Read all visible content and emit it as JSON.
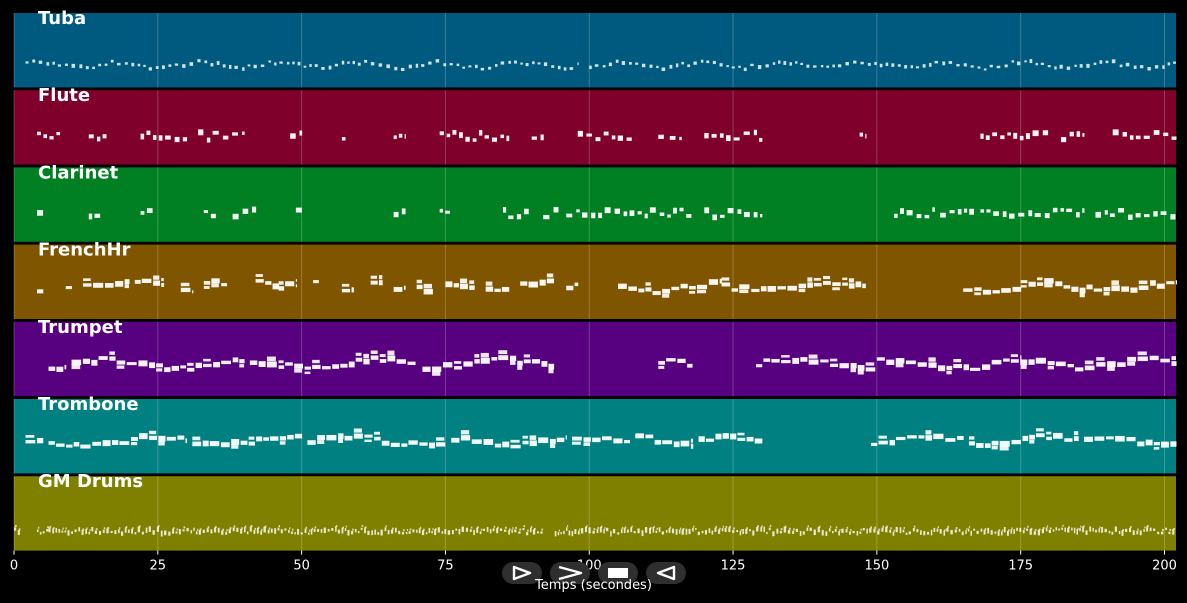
{
  "chart_data": {
    "type": "piano-roll",
    "xlabel": "Temps (secondes)",
    "xlim": [
      0,
      202
    ],
    "x_ticks": [
      0,
      25,
      50,
      75,
      100,
      125,
      150,
      175,
      200
    ],
    "grid": true,
    "tracks": [
      {
        "name": "Tuba",
        "color": "#005a80",
        "segments": [
          [
            2,
            98
          ],
          [
            100,
            202
          ]
        ],
        "style": "thin-dashes"
      },
      {
        "name": "Flute",
        "color": "#80002c",
        "segments": [
          [
            4,
            8
          ],
          [
            13,
            16
          ],
          [
            22,
            30
          ],
          [
            32,
            40
          ],
          [
            48,
            50
          ],
          [
            57,
            58
          ],
          [
            66,
            68
          ],
          [
            74,
            86
          ],
          [
            90,
            92
          ],
          [
            98,
            108
          ],
          [
            112,
            113
          ],
          [
            114,
            116
          ],
          [
            120,
            130
          ],
          [
            147,
            148
          ],
          [
            168,
            180
          ],
          [
            182,
            186
          ],
          [
            191,
            202
          ]
        ],
        "style": "sparse-blocks"
      },
      {
        "name": "Clarinet",
        "color": "#008023",
        "segments": [
          [
            4,
            5
          ],
          [
            13,
            15
          ],
          [
            22,
            24
          ],
          [
            33,
            35
          ],
          [
            38,
            42
          ],
          [
            49,
            50
          ],
          [
            66,
            68
          ],
          [
            74,
            76
          ],
          [
            85,
            90
          ],
          [
            92,
            95
          ],
          [
            96,
            118
          ],
          [
            120,
            130
          ],
          [
            153,
            160
          ],
          [
            161,
            167
          ],
          [
            168,
            186
          ],
          [
            188,
            202
          ]
        ],
        "style": "sparse-blocks"
      },
      {
        "name": "FrenchHr",
        "color": "#805500",
        "segments": [
          [
            4,
            5
          ],
          [
            9,
            10
          ],
          [
            12,
            20
          ],
          [
            21,
            26
          ],
          [
            29,
            31
          ],
          [
            33,
            37
          ],
          [
            42,
            46
          ],
          [
            46,
            49
          ],
          [
            52,
            53
          ],
          [
            57,
            59
          ],
          [
            62,
            64
          ],
          [
            66,
            68
          ],
          [
            70,
            73
          ],
          [
            75,
            80
          ],
          [
            82,
            86
          ],
          [
            88,
            94
          ],
          [
            96,
            98
          ],
          [
            105,
            123
          ],
          [
            123,
            148
          ],
          [
            165,
            175
          ],
          [
            175,
            202
          ]
        ],
        "style": "thick-line"
      },
      {
        "name": "Trumpet",
        "color": "#570080",
        "segments": [
          [
            6,
            9
          ],
          [
            10,
            40
          ],
          [
            41,
            70
          ],
          [
            71,
            94
          ],
          [
            112,
            118
          ],
          [
            129,
            150
          ],
          [
            150,
            175
          ],
          [
            175,
            202
          ]
        ],
        "style": "thick-line"
      },
      {
        "name": "Trombone",
        "color": "#008080",
        "segments": [
          [
            2,
            5
          ],
          [
            6,
            30
          ],
          [
            31,
            50
          ],
          [
            51,
            75
          ],
          [
            76,
            96
          ],
          [
            97,
            107
          ],
          [
            108,
            118
          ],
          [
            119,
            130
          ],
          [
            149,
            165
          ],
          [
            166,
            185
          ],
          [
            186,
            202
          ]
        ],
        "style": "thick-line"
      },
      {
        "name": "GM Drums",
        "color": "#808000",
        "segments": [
          [
            0,
            1
          ],
          [
            4,
            6
          ],
          [
            6,
            92
          ],
          [
            94,
            202
          ]
        ],
        "style": "drums"
      }
    ]
  },
  "transport": {
    "play_icon": "play-icon",
    "fast_forward_icon": "fast-forward-icon",
    "stop_icon": "stop-icon",
    "rewind_icon": "rewind-icon"
  }
}
